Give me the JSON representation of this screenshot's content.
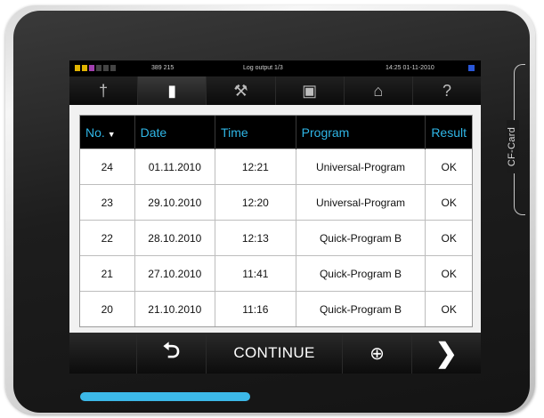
{
  "status_bar": {
    "count": "389 215",
    "title": "Log output 1/3",
    "datetime": "14:25  01-11-2010"
  },
  "tabs": [
    {
      "icon": "running-person-icon",
      "glyph": "†"
    },
    {
      "icon": "document-stack-icon",
      "glyph": "▮"
    },
    {
      "icon": "wrench-icon",
      "glyph": "⚒"
    },
    {
      "icon": "device-settings-icon",
      "glyph": "▣"
    },
    {
      "icon": "lock-icon",
      "glyph": "⌂"
    },
    {
      "icon": "help-icon",
      "glyph": "?"
    }
  ],
  "side_label": "CF-Card",
  "table": {
    "headers": [
      "No.",
      "Date",
      "Time",
      "Program",
      "Result"
    ],
    "sort_indicator": "▼",
    "rows": [
      {
        "no": "24",
        "date": "01.11.2010",
        "time": "12:21",
        "program": "Universal-Program",
        "result": "OK"
      },
      {
        "no": "23",
        "date": "29.10.2010",
        "time": "12:20",
        "program": "Universal-Program",
        "result": "OK"
      },
      {
        "no": "22",
        "date": "28.10.2010",
        "time": "12:13",
        "program": "Quick-Program B",
        "result": "OK"
      },
      {
        "no": "21",
        "date": "27.10.2010",
        "time": "11:41",
        "program": "Quick-Program B",
        "result": "OK"
      },
      {
        "no": "20",
        "date": "21.10.2010",
        "time": "11:16",
        "program": "Quick-Program B",
        "result": "OK"
      }
    ]
  },
  "bottom_bar": {
    "back_glyph": "⮌",
    "continue_label": "CONTINUE",
    "zoom_glyph": "⊕",
    "next_glyph": "❯"
  },
  "colors": {
    "accent": "#2fb6e6",
    "progress": "#3cb8e8"
  }
}
